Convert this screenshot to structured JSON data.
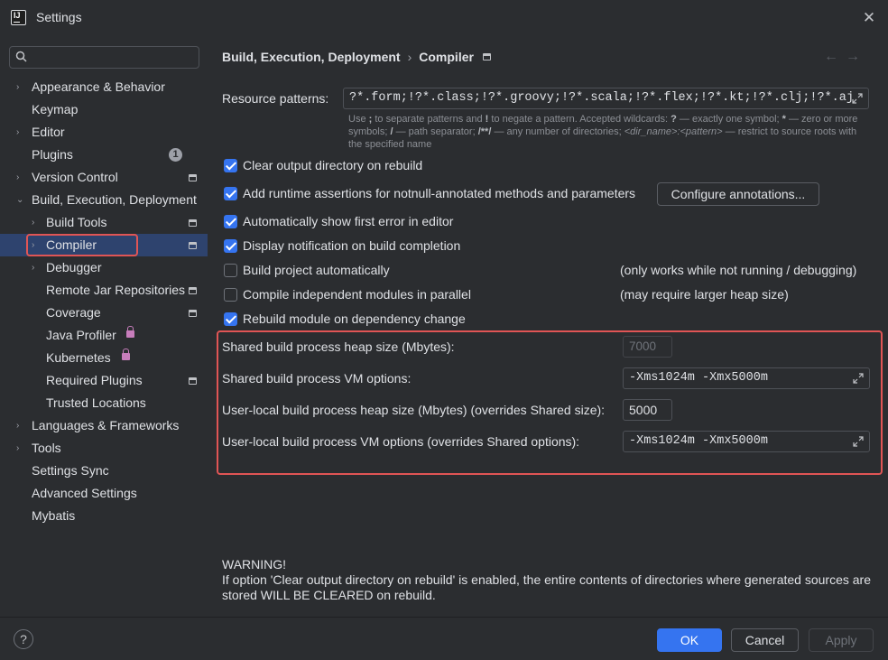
{
  "window": {
    "title": "Settings"
  },
  "search": {
    "placeholder": "",
    "value": ""
  },
  "sidebar": {
    "items": [
      {
        "label": "Appearance & Behavior",
        "chevron": "›"
      },
      {
        "label": "Keymap"
      },
      {
        "label": "Editor",
        "chevron": "›"
      },
      {
        "label": "Plugins",
        "badge": "1"
      },
      {
        "label": "Version Control",
        "chevron": "›"
      },
      {
        "label": "Build, Execution, Deployment",
        "chevron": "⌄"
      },
      {
        "label": "Build Tools",
        "chevron": "›"
      },
      {
        "label": "Compiler",
        "chevron": "›"
      },
      {
        "label": "Debugger",
        "chevron": "›"
      },
      {
        "label": "Remote Jar Repositories"
      },
      {
        "label": "Coverage"
      },
      {
        "label": "Java Profiler"
      },
      {
        "label": "Kubernetes"
      },
      {
        "label": "Required Plugins"
      },
      {
        "label": "Trusted Locations"
      },
      {
        "label": "Languages & Frameworks",
        "chevron": "›"
      },
      {
        "label": "Tools",
        "chevron": "›"
      },
      {
        "label": "Settings Sync"
      },
      {
        "label": "Advanced Settings"
      },
      {
        "label": "Mybatis"
      }
    ]
  },
  "main": {
    "breadcrumb": {
      "parent": "Build, Execution, Deployment",
      "separator": "›",
      "current": "Compiler"
    },
    "nav": {
      "back": "←",
      "forward": "→"
    },
    "resource_patterns": {
      "label": "Resource patterns:",
      "value": "?*.form;!?*.class;!?*.groovy;!?*.scala;!?*.flex;!?*.kt;!?*.clj;!?*.aj",
      "hint": {
        "p1": "Use ",
        "s1": ";",
        "p2": " to separate patterns and ",
        "s2": "!",
        "p3": " to negate a pattern. Accepted wildcards: ",
        "s3": "?",
        "p4": " — exactly one symbol; ",
        "s4": "*",
        "p5": " — zero or more symbols; ",
        "s5": "/",
        "p6": " — path separator; ",
        "s6": "/**/",
        "p7": " — any number of directories; ",
        "s7": "<dir_name>:<pattern>",
        "p8": " — restrict to source roots with the specified name"
      }
    },
    "options": {
      "clear_output": {
        "label": "Clear output directory on rebuild",
        "checked": true
      },
      "runtime_assertions": {
        "label": "Add runtime assertions for notnull-annotated methods and parameters",
        "checked": true,
        "button": "Configure annotations..."
      },
      "show_first_error": {
        "label": "Automatically show first error in editor",
        "checked": true
      },
      "display_notification": {
        "label": "Display notification on build completion",
        "checked": true
      },
      "build_auto": {
        "label": "Build project automatically",
        "checked": false,
        "note": "(only works while not running / debugging)"
      },
      "compile_parallel": {
        "label": "Compile independent modules in parallel",
        "checked": false,
        "note": "(may require larger heap size)"
      },
      "rebuild_dependency": {
        "label": "Rebuild module on dependency change",
        "checked": true
      }
    },
    "heap": {
      "shared_heap": {
        "label": "Shared build process heap size (Mbytes):",
        "value": "7000"
      },
      "shared_vm": {
        "label": "Shared build process VM options:",
        "value": "-Xms1024m -Xmx5000m"
      },
      "user_heap": {
        "label": "User-local build process heap size (Mbytes) (overrides Shared size):",
        "value": "5000"
      },
      "user_vm": {
        "label": "User-local build process VM options (overrides Shared options):",
        "value": "-Xms1024m -Xmx5000m"
      }
    },
    "warning": {
      "title": "WARNING!",
      "text": "If option 'Clear output directory on rebuild' is enabled, the entire contents of directories where generated sources are stored WILL BE CLEARED on rebuild."
    }
  },
  "footer": {
    "help": "?",
    "ok": "OK",
    "cancel": "Cancel",
    "apply": "Apply"
  },
  "colors": {
    "accent": "#3574f0",
    "background": "#2b2d30",
    "highlight": "#e05555",
    "selection": "#2e436e"
  }
}
